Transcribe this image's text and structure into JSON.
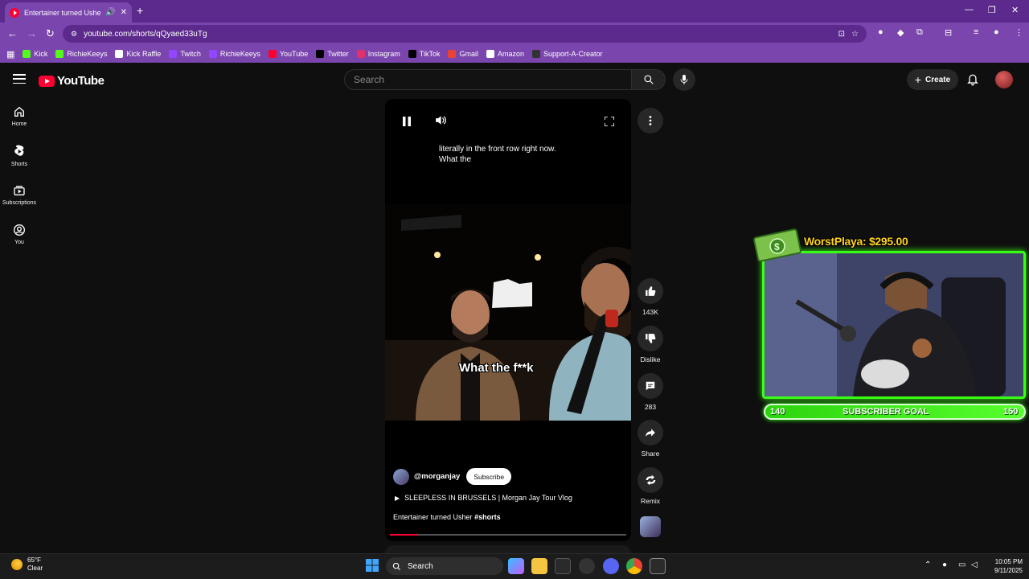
{
  "browser": {
    "tab_title": "Entertainer turned Usher #shorts",
    "url": "youtube.com/shorts/qQyaed33uTg",
    "bookmarks": [
      {
        "label": "Kick",
        "color": "#53fc18"
      },
      {
        "label": "RichieKeeys",
        "color": "#53fc18"
      },
      {
        "label": "Kick Raffle",
        "color": "#ffffff"
      },
      {
        "label": "Twitch",
        "color": "#9146ff"
      },
      {
        "label": "RichieKeeys",
        "color": "#9146ff"
      },
      {
        "label": "YouTube",
        "color": "#ff0033"
      },
      {
        "label": "Twitter",
        "color": "#000000"
      },
      {
        "label": "Instagram",
        "color": "#e1306c"
      },
      {
        "label": "TikTok",
        "color": "#000000"
      },
      {
        "label": "Gmail",
        "color": "#ea4335"
      },
      {
        "label": "Amazon",
        "color": "#ffffff"
      },
      {
        "label": "Support-A-Creator",
        "color": "#333333"
      }
    ]
  },
  "youtube": {
    "logo_text": "YouTube",
    "search_placeholder": "Search",
    "create_label": "Create",
    "nav": [
      {
        "label": "Home",
        "icon": "home-icon"
      },
      {
        "label": "Shorts",
        "icon": "shorts-icon"
      },
      {
        "label": "Subscriptions",
        "icon": "subscriptions-icon"
      },
      {
        "label": "You",
        "icon": "you-icon"
      }
    ]
  },
  "video": {
    "caption_top": "literally in the front row right now.\nWhat the",
    "caption_mid": "What the f**k",
    "channel": "@morganjay",
    "subscribe_label": "Subscribe",
    "playlist": "SLEEPLESS IN BRUSSELS | Morgan Jay Tour Vlog",
    "title": "Entertainer turned Usher",
    "hashtag": "#shorts",
    "progress": 0.12
  },
  "actions": {
    "likes": "143K",
    "dislike": "Dislike",
    "comments": "283",
    "share": "Share",
    "remix": "Remix"
  },
  "overlay": {
    "donation": "WorstPlaya: $295.00",
    "goal_label": "SUBSCRIBER GOAL",
    "goal_current": "140",
    "goal_target": "150",
    "accent": "#39ff14"
  },
  "taskbar": {
    "temp": "65°F",
    "condition": "Clear",
    "search_label": "Search",
    "time": "10:05 PM",
    "date": "9/11/2025"
  }
}
